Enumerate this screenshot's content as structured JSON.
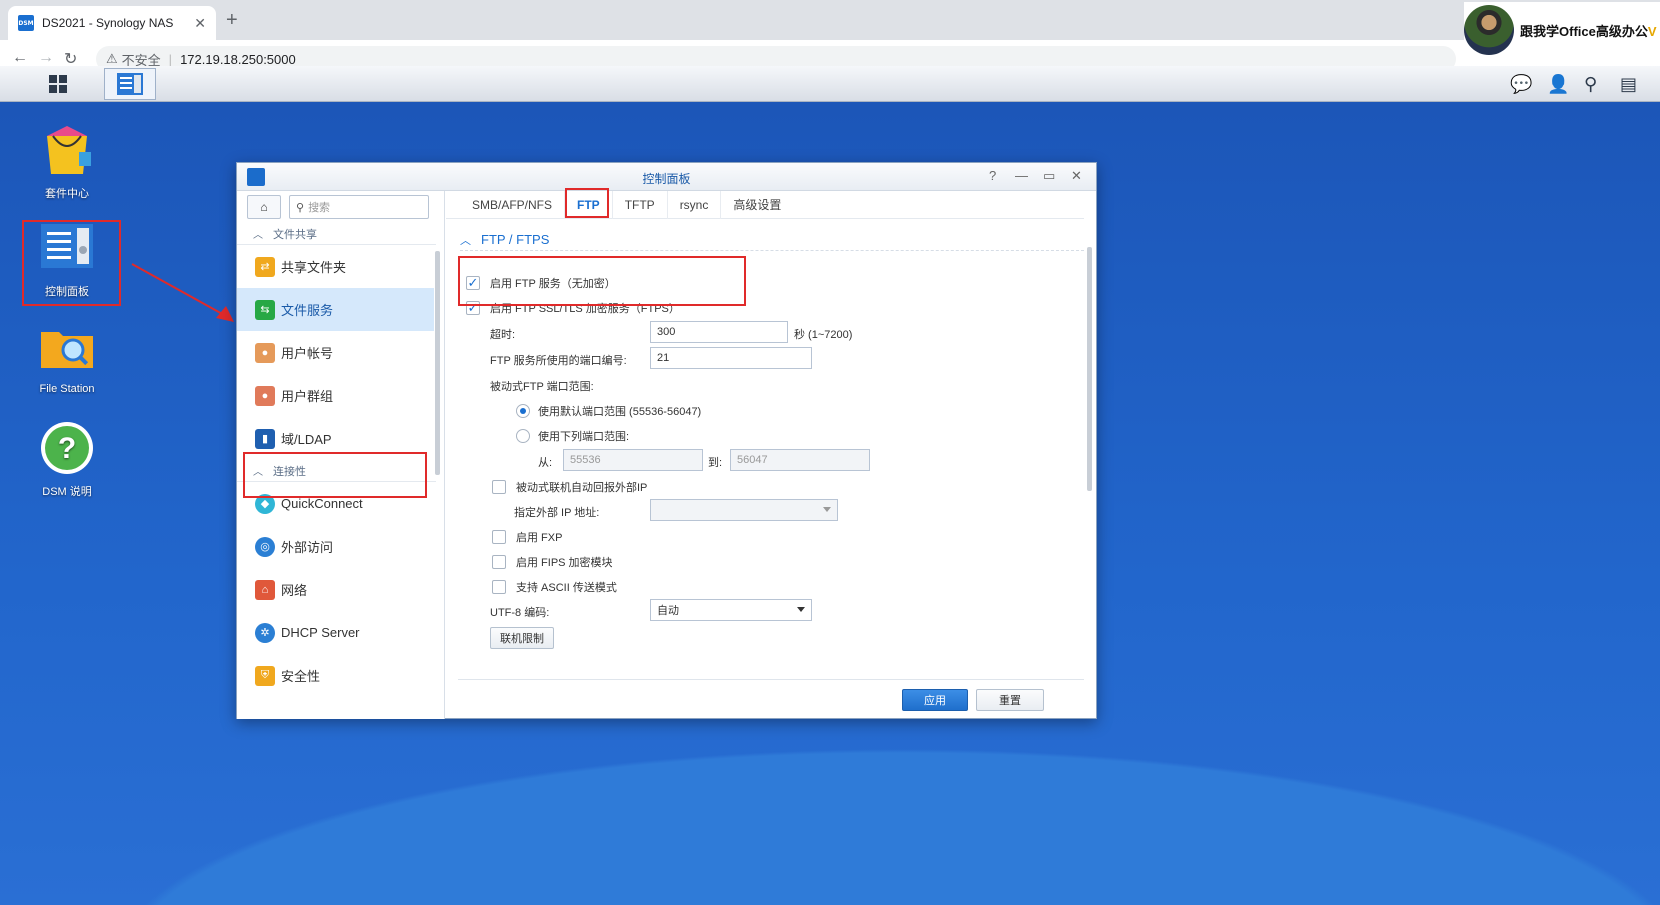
{
  "browser": {
    "tab_title": "DS2021 - Synology NAS",
    "tab_close": "✕",
    "new_tab": "+",
    "favicon_text": "DSM",
    "insecure_label": "不安全",
    "url": "172.19.18.250:5000"
  },
  "overlay": {
    "text": "跟我学Office高级办公",
    "suffix": "V"
  },
  "desktop": {
    "icons": [
      {
        "label": "套件中心"
      },
      {
        "label": "控制面板"
      },
      {
        "label": "File Station"
      },
      {
        "label": "DSM 说明"
      }
    ]
  },
  "window": {
    "title": "控制面板",
    "controls": {
      "help": "?",
      "minimize": "—",
      "maximize": "▭",
      "close": "✕"
    },
    "search_placeholder": "搜索",
    "sections": [
      {
        "label": "文件共享"
      },
      {
        "label": "连接性"
      }
    ],
    "items": [
      {
        "label": "共享文件夹",
        "color": "#f0a81e"
      },
      {
        "label": "文件服务",
        "color": "#27a845"
      },
      {
        "label": "用户帐号",
        "color": "#e59a5a"
      },
      {
        "label": "用户群组",
        "color": "#e07a5a"
      },
      {
        "label": "域/LDAP",
        "color": "#1f5fb0"
      },
      {
        "label": "QuickConnect",
        "color": "#2fb6d6"
      },
      {
        "label": "外部访问",
        "color": "#2b7fd4"
      },
      {
        "label": "网络",
        "color": "#e0583a"
      },
      {
        "label": "DHCP Server",
        "color": "#2b7fd4"
      },
      {
        "label": "安全性",
        "color": "#f0a81e"
      }
    ],
    "tabs": [
      "SMB/AFP/NFS",
      "FTP",
      "TFTP",
      "rsync",
      "高级设置"
    ],
    "active_tab": "FTP",
    "section_title": "FTP / FTPS",
    "form": {
      "enable_ftp": "启用 FTP 服务（无加密）",
      "enable_ftps": "启用 FTP SSL/TLS 加密服务（FTPS）",
      "timeout_label": "超时:",
      "timeout_value": "300",
      "timeout_unit": "秒 (1~7200)",
      "port_label": "FTP 服务所使用的端口编号:",
      "port_value": "21",
      "passive_label": "被动式FTP 端口范围:",
      "default_range": "使用默认端口范围 (55536-56047)",
      "custom_range": "使用下列端口范围:",
      "from_label": "从:",
      "from_value": "55536",
      "to_label": "到:",
      "to_value": "56047",
      "report_ip": "被动式联机自动回报外部IP",
      "external_ip_label": "指定外部 IP 地址:",
      "enable_fxp": "启用 FXP",
      "enable_fips": "启用 FIPS 加密模块",
      "ascii_mode": "支持 ASCII 传送模式",
      "utf8_label": "UTF-8 编码:",
      "utf8_value": "自动",
      "conn_limit": "联机限制"
    },
    "apply": "应用",
    "reset": "重置"
  },
  "colors": {
    "accent": "#1a6fd0",
    "highlight": "#e02a2a"
  }
}
